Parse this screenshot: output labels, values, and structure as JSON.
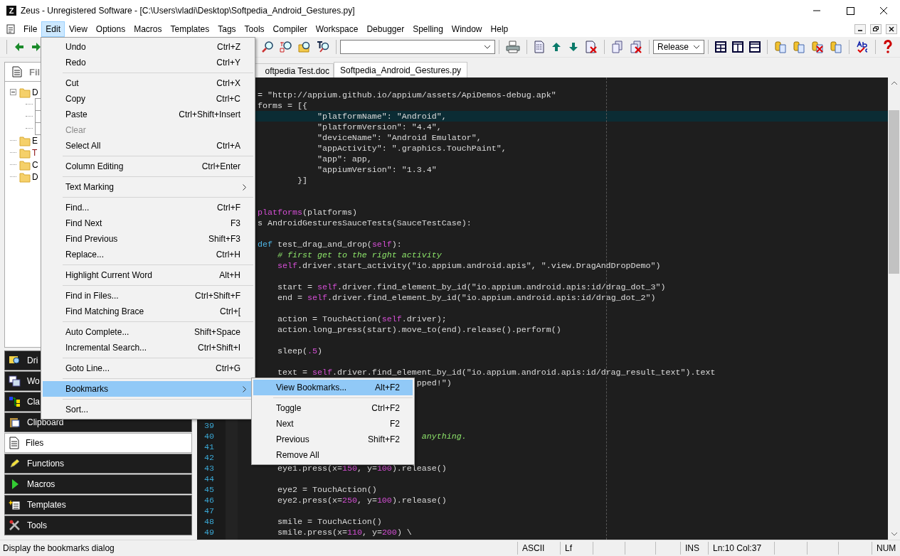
{
  "window": {
    "app_icon_letter": "Z",
    "title": "Zeus - Unregistered Software - [C:\\Users\\vladi\\Desktop\\Softpedia_Android_Gestures.py]"
  },
  "menu_bar": [
    {
      "label": "File",
      "selected": false
    },
    {
      "label": "Edit",
      "selected": true
    },
    {
      "label": "View",
      "selected": false
    },
    {
      "label": "Options",
      "selected": false
    },
    {
      "label": "Macros",
      "selected": false
    },
    {
      "label": "Templates",
      "selected": false
    },
    {
      "label": "Tags",
      "selected": false
    },
    {
      "label": "Tools",
      "selected": false
    },
    {
      "label": "Compiler",
      "selected": false
    },
    {
      "label": "Workspace",
      "selected": false
    },
    {
      "label": "Debugger",
      "selected": false
    },
    {
      "label": "Spelling",
      "selected": false
    },
    {
      "label": "Window",
      "selected": false
    },
    {
      "label": "Help",
      "selected": false
    }
  ],
  "toolbar": {
    "config_combo": {
      "value": "Release"
    }
  },
  "side_panel": {
    "tab": {
      "label": "Fil"
    },
    "tree": [
      {
        "kind": "folder",
        "label": "D",
        "expanded": true,
        "children": [
          {
            "kind": "file"
          },
          {
            "kind": "file"
          },
          {
            "kind": "file"
          }
        ]
      },
      {
        "kind": "folder",
        "label": "E"
      },
      {
        "kind": "folder",
        "label": "T"
      },
      {
        "kind": "folder",
        "label": "C"
      },
      {
        "kind": "folder",
        "label": "D"
      }
    ],
    "buttons": [
      {
        "label": "Dri",
        "selected": false
      },
      {
        "label": "Wo",
        "selected": false
      },
      {
        "label": "Cla",
        "selected": false
      },
      {
        "label": "Clipboard",
        "selected": false
      },
      {
        "label": "Files",
        "selected": true
      },
      {
        "label": "Functions",
        "selected": false
      },
      {
        "label": "Macros",
        "selected": false
      },
      {
        "label": "Templates",
        "selected": false
      },
      {
        "label": "Tools",
        "selected": false
      }
    ]
  },
  "editor": {
    "tabs": [
      {
        "label": "oftpedia Test.doc",
        "selected": false
      },
      {
        "label": "Softpedia_Android_Gestures.py",
        "selected": true
      }
    ],
    "lines": [
      {
        "current": false
      },
      {
        "current": false,
        "segments": [
          {
            "kind": "plain",
            "text": "    = \"http://appium.github.io/appium/assets/ApiDemos-debug.apk\""
          }
        ]
      },
      {
        "current": false,
        "segments": [
          {
            "kind": "plain",
            "text": "    forms = [{"
          }
        ]
      },
      {
        "current": true,
        "segments": [
          {
            "kind": "plain",
            "text": "                \"platformName\": \"Android\","
          }
        ]
      },
      {
        "current": false,
        "segments": [
          {
            "kind": "plain",
            "text": "                \"platformVersion\": \"4.4\","
          }
        ]
      },
      {
        "current": false,
        "segments": [
          {
            "kind": "plain",
            "text": "                \"deviceName\": \"Android Emulator\","
          }
        ]
      },
      {
        "current": false,
        "segments": [
          {
            "kind": "plain",
            "text": "                \"appActivity\": \".graphics.TouchPaint\","
          }
        ]
      },
      {
        "current": false,
        "segments": [
          {
            "kind": "plain",
            "text": "                \"app\": app,"
          }
        ]
      },
      {
        "current": false,
        "segments": [
          {
            "kind": "plain",
            "text": "                \"appiumVersion\": \"1.3.4\""
          }
        ]
      },
      {
        "current": false,
        "segments": [
          {
            "kind": "plain",
            "text": "            }]"
          }
        ]
      },
      {
        "current": false
      },
      {
        "current": false
      },
      {
        "current": false,
        "segments": [
          {
            "kind": "decorator",
            "text": "    platforms"
          },
          {
            "kind": "plain",
            "text": "(platforms)"
          }
        ]
      },
      {
        "current": false,
        "segments": [
          {
            "kind": "plain",
            "text": "    s AndroidGesturesSauceTests(SauceTestCase):"
          }
        ]
      },
      {
        "current": false
      },
      {
        "current": false,
        "segments": [
          {
            "kind": "keyword",
            "text": "    def"
          },
          {
            "kind": "plain",
            "text": " test_drag_and_drop("
          },
          {
            "kind": "self",
            "text": "self"
          },
          {
            "kind": "plain",
            "text": "):"
          }
        ]
      },
      {
        "current": false,
        "segments": [
          {
            "kind": "comment",
            "text": "        # first get to the right activity"
          }
        ]
      },
      {
        "current": false,
        "segments": [
          {
            "kind": "self",
            "text": "        self"
          },
          {
            "kind": "plain",
            "text": ".driver.start_activity(\"io.appium.android.apis\", \".view.DragAndDropDemo\")"
          }
        ]
      },
      {
        "current": false
      },
      {
        "current": false,
        "segments": [
          {
            "kind": "plain",
            "text": "        start = "
          },
          {
            "kind": "self",
            "text": "self"
          },
          {
            "kind": "plain",
            "text": ".driver.find_element_by_id(\"io.appium.android.apis:id/drag_dot_3\")"
          }
        ]
      },
      {
        "current": false,
        "segments": [
          {
            "kind": "plain",
            "text": "        end = "
          },
          {
            "kind": "self",
            "text": "self"
          },
          {
            "kind": "plain",
            "text": ".driver.find_element_by_id(\"io.appium.android.apis:id/drag_dot_2\")"
          }
        ]
      },
      {
        "current": false
      },
      {
        "current": false,
        "segments": [
          {
            "kind": "plain",
            "text": "        action = TouchAction("
          },
          {
            "kind": "self",
            "text": "self"
          },
          {
            "kind": "plain",
            "text": ".driver);"
          }
        ]
      },
      {
        "current": false,
        "segments": [
          {
            "kind": "plain",
            "text": "        action.long_press(start).move_to(end).release().perform()"
          }
        ]
      },
      {
        "current": false
      },
      {
        "current": false,
        "segments": [
          {
            "kind": "plain",
            "text": "        sleep("
          },
          {
            "kind": "number",
            "text": ".5"
          },
          {
            "kind": "plain",
            "text": ")"
          }
        ]
      },
      {
        "current": false
      },
      {
        "current": false,
        "segments": [
          {
            "kind": "plain",
            "text": "        text = "
          },
          {
            "kind": "self",
            "text": "self"
          },
          {
            "kind": "plain",
            "text": ".driver.find_element_by_id(\"io.appium.android.apis:id/drag_result_text\").text"
          }
        ]
      },
      {
        "current": false,
        "segments": [
          {
            "kind": "plain",
            "text": "                                    pped!\")"
          }
        ]
      },
      {
        "current": false
      },
      {
        "current": false
      },
      {
        "current": false
      },
      {
        "current": false,
        "number": "39"
      },
      {
        "current": false,
        "number": "40",
        "segments": [
          {
            "kind": "comment",
            "text": "                                     anything."
          }
        ]
      },
      {
        "current": false,
        "number": "41"
      },
      {
        "current": false,
        "number": "42"
      },
      {
        "current": false,
        "number": "43",
        "segments": [
          {
            "kind": "plain",
            "text": "        eye1.press(x="
          },
          {
            "kind": "number",
            "text": "150"
          },
          {
            "kind": "plain",
            "text": ", y="
          },
          {
            "kind": "number",
            "text": "100"
          },
          {
            "kind": "plain",
            "text": ").release()"
          }
        ]
      },
      {
        "current": false,
        "number": "44"
      },
      {
        "current": false,
        "number": "45",
        "segments": [
          {
            "kind": "plain",
            "text": "        eye2 = TouchAction()"
          }
        ]
      },
      {
        "current": false,
        "number": "46",
        "segments": [
          {
            "kind": "plain",
            "text": "        eye2.press(x="
          },
          {
            "kind": "number",
            "text": "250"
          },
          {
            "kind": "plain",
            "text": ", y="
          },
          {
            "kind": "number",
            "text": "100"
          },
          {
            "kind": "plain",
            "text": ").release()"
          }
        ]
      },
      {
        "current": false,
        "number": "47"
      },
      {
        "current": false,
        "number": "48",
        "segments": [
          {
            "kind": "plain",
            "text": "        smile = TouchAction()"
          }
        ]
      },
      {
        "current": false,
        "number": "49",
        "segments": [
          {
            "kind": "plain",
            "text": "        smile.press(x="
          },
          {
            "kind": "number",
            "text": "110"
          },
          {
            "kind": "plain",
            "text": ", y="
          },
          {
            "kind": "number",
            "text": "200"
          },
          {
            "kind": "plain",
            "text": ") \\"
          }
        ]
      }
    ]
  },
  "edit_menu": [
    {
      "kind": "item",
      "label": "Undo",
      "shortcut": "Ctrl+Z",
      "disabled": false,
      "selected": false,
      "submenu": false
    },
    {
      "kind": "item",
      "label": "Redo",
      "shortcut": "Ctrl+Y",
      "disabled": false,
      "selected": false,
      "submenu": false
    },
    {
      "kind": "separator"
    },
    {
      "kind": "item",
      "label": "Cut",
      "shortcut": "Ctrl+X",
      "disabled": false,
      "selected": false,
      "submenu": false
    },
    {
      "kind": "item",
      "label": "Copy",
      "shortcut": "Ctrl+C",
      "disabled": false,
      "selected": false,
      "submenu": false
    },
    {
      "kind": "item",
      "label": "Paste",
      "shortcut": "Ctrl+Shift+Insert",
      "disabled": false,
      "selected": false,
      "submenu": false
    },
    {
      "kind": "item",
      "label": "Clear",
      "disabled": true,
      "selected": false,
      "submenu": false
    },
    {
      "kind": "item",
      "label": "Select All",
      "shortcut": "Ctrl+A",
      "disabled": false,
      "selected": false,
      "submenu": false
    },
    {
      "kind": "separator"
    },
    {
      "kind": "item",
      "label": "Column Editing",
      "shortcut": "Ctrl+Enter",
      "disabled": false,
      "selected": false,
      "submenu": false
    },
    {
      "kind": "separator"
    },
    {
      "kind": "item",
      "label": "Text Marking",
      "disabled": false,
      "selected": false,
      "submenu": true
    },
    {
      "kind": "separator"
    },
    {
      "kind": "item",
      "label": "Find...",
      "shortcut": "Ctrl+F",
      "disabled": false,
      "selected": false,
      "submenu": false
    },
    {
      "kind": "item",
      "label": "Find Next",
      "shortcut": "F3",
      "disabled": false,
      "selected": false,
      "submenu": false
    },
    {
      "kind": "item",
      "label": "Find Previous",
      "shortcut": "Shift+F3",
      "disabled": false,
      "selected": false,
      "submenu": false
    },
    {
      "kind": "item",
      "label": "Replace...",
      "shortcut": "Ctrl+H",
      "disabled": false,
      "selected": false,
      "submenu": false
    },
    {
      "kind": "separator"
    },
    {
      "kind": "item",
      "label": "Highlight Current Word",
      "shortcut": "Alt+H",
      "disabled": false,
      "selected": false,
      "submenu": false
    },
    {
      "kind": "separator"
    },
    {
      "kind": "item",
      "label": "Find in Files...",
      "shortcut": "Ctrl+Shift+F",
      "disabled": false,
      "selected": false,
      "submenu": false
    },
    {
      "kind": "item",
      "label": "Find Matching Brace",
      "shortcut": "Ctrl+[",
      "disabled": false,
      "selected": false,
      "submenu": false
    },
    {
      "kind": "separator"
    },
    {
      "kind": "item",
      "label": "Auto Complete...",
      "shortcut": "Shift+Space",
      "disabled": false,
      "selected": false,
      "submenu": false
    },
    {
      "kind": "item",
      "label": "Incremental Search...",
      "shortcut": "Ctrl+Shift+I",
      "disabled": false,
      "selected": false,
      "submenu": false
    },
    {
      "kind": "separator"
    },
    {
      "kind": "item",
      "label": "Goto Line...",
      "shortcut": "Ctrl+G",
      "disabled": false,
      "selected": false,
      "submenu": false
    },
    {
      "kind": "separator"
    },
    {
      "kind": "item",
      "label": "Bookmarks",
      "disabled": false,
      "selected": true,
      "submenu": true
    },
    {
      "kind": "separator"
    },
    {
      "kind": "item",
      "label": "Sort...",
      "disabled": false,
      "selected": false,
      "submenu": false
    }
  ],
  "bookmarks_menu": [
    {
      "kind": "item",
      "label": "View Bookmarks...",
      "shortcut": "Alt+F2",
      "selected": true
    },
    {
      "kind": "separator"
    },
    {
      "kind": "item",
      "label": "Toggle",
      "shortcut": "Ctrl+F2",
      "selected": false
    },
    {
      "kind": "item",
      "label": "Next",
      "shortcut": "F2",
      "selected": false
    },
    {
      "kind": "item",
      "label": "Previous",
      "shortcut": "Shift+F2",
      "selected": false
    },
    {
      "kind": "item",
      "label": "Remove All",
      "selected": false
    }
  ],
  "status_bar": {
    "message": "Display the bookmarks dialog",
    "panes": [
      {
        "text": "ASCII"
      },
      {
        "text": "Lf"
      },
      {
        "text": "INS"
      },
      {
        "text": "Ln:10 Col:37"
      },
      {
        "text": "NUM"
      }
    ]
  }
}
